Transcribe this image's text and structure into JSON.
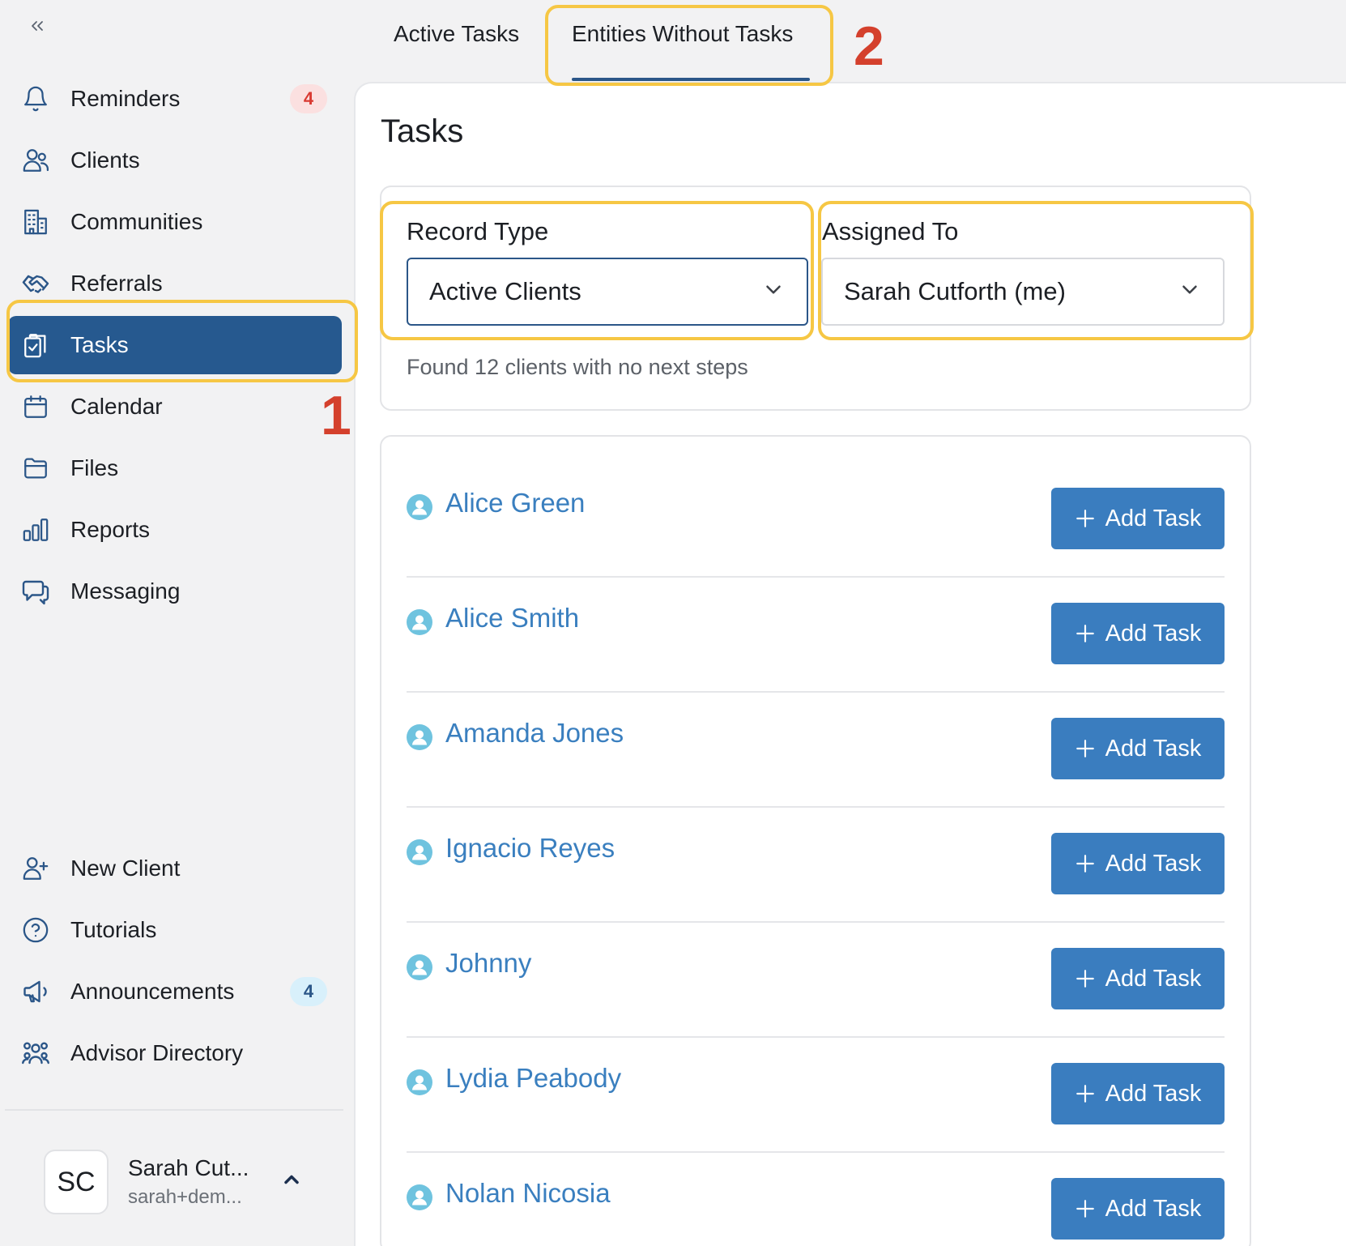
{
  "sidebar": {
    "collapse_icon": "chevrons-left-icon",
    "nav": [
      {
        "label": "Reminders",
        "icon": "bell-icon",
        "badge": "4"
      },
      {
        "label": "Clients",
        "icon": "users-icon"
      },
      {
        "label": "Communities",
        "icon": "building-icon"
      },
      {
        "label": "Referrals",
        "icon": "handshake-icon"
      },
      {
        "label": "Tasks",
        "icon": "clipboard-check-icon",
        "active": true
      },
      {
        "label": "Calendar",
        "icon": "calendar-icon"
      },
      {
        "label": "Files",
        "icon": "folder-icon"
      },
      {
        "label": "Reports",
        "icon": "bar-chart-icon"
      },
      {
        "label": "Messaging",
        "icon": "chat-bubbles-icon"
      }
    ],
    "bottom_nav": [
      {
        "label": "New Client",
        "icon": "user-plus-icon"
      },
      {
        "label": "Tutorials",
        "icon": "question-circle-icon"
      },
      {
        "label": "Announcements",
        "icon": "megaphone-icon",
        "badge": "4"
      },
      {
        "label": "Advisor Directory",
        "icon": "user-group-icon"
      }
    ],
    "user": {
      "initials": "SC",
      "name": "Sarah Cut...",
      "email": "sarah+dem...",
      "chevron_icon": "chevron-up-icon"
    }
  },
  "tabs": [
    {
      "label": "Active Tasks"
    },
    {
      "label": "Entities Without Tasks",
      "active": true
    }
  ],
  "page": {
    "title": "Tasks",
    "filters": {
      "record_type_label": "Record Type",
      "record_type_value": "Active Clients",
      "assigned_to_label": "Assigned To",
      "assigned_to_value": "Sarah Cutforth (me)"
    },
    "found_text": "Found 12 clients with no next steps",
    "add_task_label": "Add Task",
    "clients": [
      {
        "name": "Alice Green"
      },
      {
        "name": "Alice Smith"
      },
      {
        "name": "Amanda Jones"
      },
      {
        "name": "Ignacio Reyes"
      },
      {
        "name": "Johnny"
      },
      {
        "name": "Lydia Peabody"
      },
      {
        "name": "Nolan Nicosia"
      }
    ]
  },
  "annotations": {
    "step1": "1",
    "step2": "2",
    "highlight_color": "#f6c744",
    "number_color": "#d4402c"
  },
  "colors": {
    "primary": "#26598f",
    "button": "#3a7dbf",
    "link": "#3a7fbf"
  }
}
